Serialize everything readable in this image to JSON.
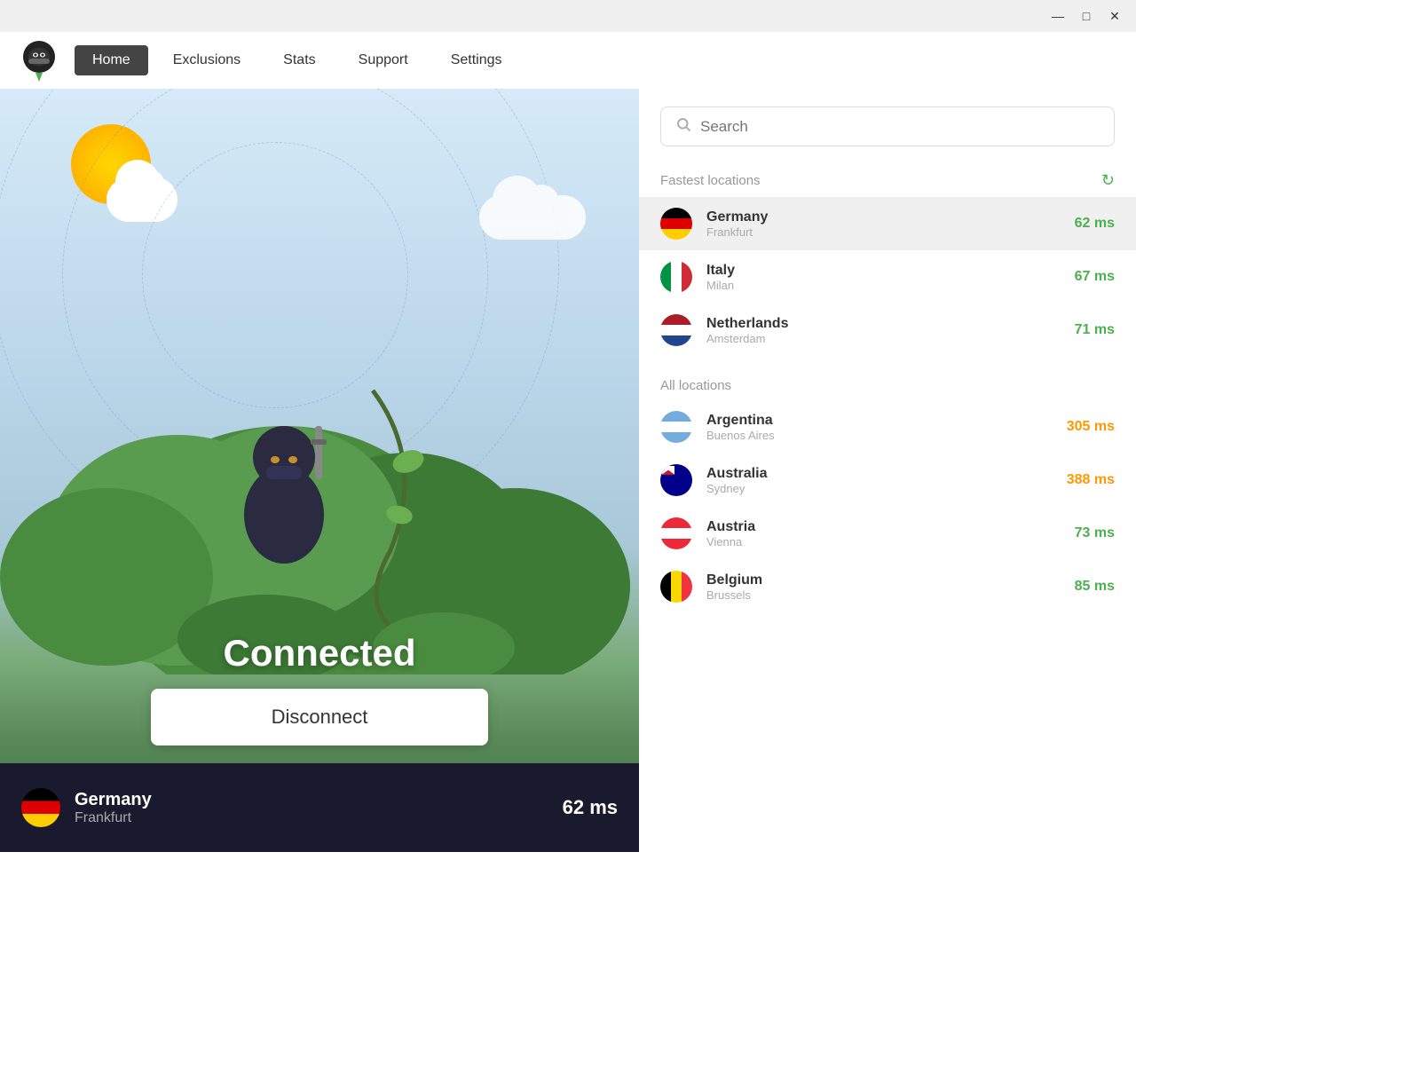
{
  "titleBar": {
    "minimize": "—",
    "maximize": "□",
    "close": "✕"
  },
  "nav": {
    "logo_alt": "VPN Ninja Logo",
    "items": [
      {
        "id": "home",
        "label": "Home",
        "active": true
      },
      {
        "id": "exclusions",
        "label": "Exclusions",
        "active": false
      },
      {
        "id": "stats",
        "label": "Stats",
        "active": false
      },
      {
        "id": "support",
        "label": "Support",
        "active": false
      },
      {
        "id": "settings",
        "label": "Settings",
        "active": false
      }
    ]
  },
  "status": {
    "connected_label": "Connected",
    "disconnect_label": "Disconnect"
  },
  "bottomBar": {
    "country": "Germany",
    "city": "Frankfurt",
    "ping": "62 ms",
    "flag_emoji": "🇩🇪"
  },
  "rightPanel": {
    "search_placeholder": "Search",
    "refresh_icon": "↻",
    "fastest_locations_label": "Fastest locations",
    "all_locations_label": "All locations",
    "fastestLocations": [
      {
        "country": "Germany",
        "city": "Frankfurt",
        "ping": "62 ms",
        "ping_color": "green",
        "flag": "de",
        "selected": true
      },
      {
        "country": "Italy",
        "city": "Milan",
        "ping": "67 ms",
        "ping_color": "green",
        "flag": "it",
        "selected": false
      },
      {
        "country": "Netherlands",
        "city": "Amsterdam",
        "ping": "71 ms",
        "ping_color": "green",
        "flag": "nl",
        "selected": false
      }
    ],
    "allLocations": [
      {
        "country": "Argentina",
        "city": "Buenos Aires",
        "ping": "305 ms",
        "ping_color": "orange",
        "flag": "ar",
        "selected": false
      },
      {
        "country": "Australia",
        "city": "Sydney",
        "ping": "388 ms",
        "ping_color": "orange",
        "flag": "au",
        "selected": false
      },
      {
        "country": "Austria",
        "city": "Vienna",
        "ping": "73 ms",
        "ping_color": "green",
        "flag": "at",
        "selected": false
      },
      {
        "country": "Belgium",
        "city": "Brussels",
        "ping": "85 ms",
        "ping_color": "green",
        "flag": "be",
        "selected": false
      }
    ]
  }
}
